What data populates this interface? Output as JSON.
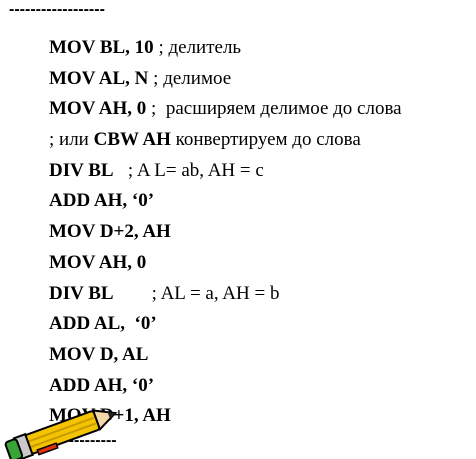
{
  "separator_top": "------------------",
  "separator_bottom": "-----------",
  "lines": [
    {
      "instr": "MOV BL, 10",
      "comment": " ; делитель"
    },
    {
      "instr": "MOV AL, N",
      "comment": " ; делимое"
    },
    {
      "instr": "MOV AH, 0",
      "comment": " ;  расширяем делимое до слова"
    },
    {
      "prefix": "; или ",
      "instr": "CBW AH",
      "comment": " конвертируем до слова"
    },
    {
      "instr": "DIV BL",
      "comment": "   ; A L= ab, AH = c"
    },
    {
      "instr": "ADD AH, ‘0’",
      "comment": ""
    },
    {
      "instr": "MOV D+2, AH",
      "comment": ""
    },
    {
      "instr": "MOV AH, 0",
      "comment": ""
    },
    {
      "instr": "DIV BL",
      "comment": "        ; AL = a, AH = b"
    },
    {
      "instr": "ADD AL,  ‘0’",
      "comment": ""
    },
    {
      "instr": "MOV D, AL",
      "comment": ""
    },
    {
      "instr": "ADD AH, ‘0’",
      "comment": ""
    },
    {
      "instr": "MOV D+1, AH",
      "comment": ""
    }
  ],
  "icons": {
    "pencil": "pencil-icon"
  },
  "colors": {
    "text": "#000000",
    "pencil_body": "#f5c400",
    "pencil_accent": "#e03010",
    "pencil_eraser": "#3aa537"
  }
}
